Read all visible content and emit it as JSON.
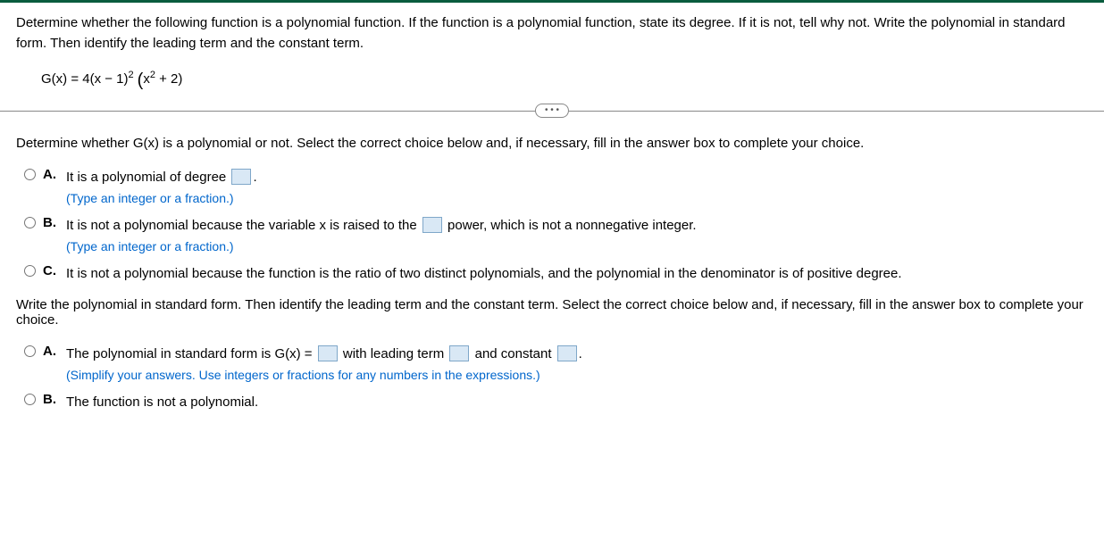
{
  "problem": {
    "statement": "Determine whether the following function is a polynomial function. If the function is a polynomial function, state its degree. If it is not, tell why not. Write the polynomial in standard form. Then identify the leading term and the constant term.",
    "function_label": "G(x) = 4(x − 1)",
    "function_exp1": "2",
    "function_mid": " (x",
    "function_exp2": "2",
    "function_tail": " + 2)"
  },
  "divider_label": "• • •",
  "q1": {
    "prompt": "Determine whether G(x) is a polynomial or not. Select the correct choice below and, if necessary, fill in the answer box to complete your choice.",
    "optA": {
      "letter": "A.",
      "text_pre": "It is a polynomial of degree ",
      "text_post": ".",
      "hint": "(Type an integer or a fraction.)"
    },
    "optB": {
      "letter": "B.",
      "text_pre": "It is not a polynomial because the variable x is raised to the ",
      "text_post": " power, which is not a nonnegative integer.",
      "hint": "(Type an integer or a fraction.)"
    },
    "optC": {
      "letter": "C.",
      "text": "It is not a polynomial because the function is the ratio of two distinct polynomials, and the polynomial in the denominator is of positive degree."
    }
  },
  "q2": {
    "prompt": "Write the polynomial in standard form. Then identify the leading term and the constant term. Select the correct choice below and, if necessary, fill in the answer box to complete your choice.",
    "optA": {
      "letter": "A.",
      "pre": "The polynomial in standard form is G(x) = ",
      "mid1": " with leading term ",
      "mid2": " and constant ",
      "post": ".",
      "hint": "(Simplify your answers. Use integers or fractions for any numbers in the expressions.)"
    },
    "optB": {
      "letter": "B.",
      "text": "The function is not a polynomial."
    }
  }
}
